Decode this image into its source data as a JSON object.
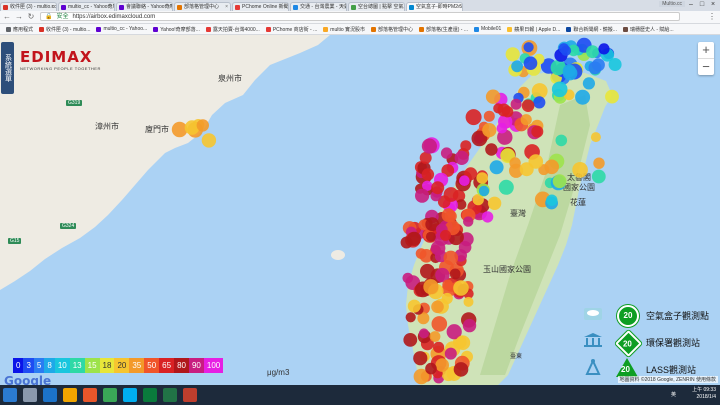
{
  "browser": {
    "tabs": [
      {
        "label": "收件匣 (3) - multio.cc@...",
        "color": "#d93025"
      },
      {
        "label": "multio_cc - Yahoo奇摩...",
        "color": "#5f01d1"
      },
      {
        "label": "會議聯絡 - Yahoo奇摩...",
        "color": "#5f01d1"
      },
      {
        "label": "部落格管理中心",
        "color": "#e37400"
      },
      {
        "label": "PChome Online 新聞台",
        "color": "#e53935"
      },
      {
        "label": "交通 - 台灣農業 - 天氣...",
        "color": "#1e88e5"
      },
      {
        "label": "空台總圖 | 點擊 空氣...",
        "color": "#43a047"
      },
      {
        "label": "空氣盒子-即時PM2.5",
        "color": "#0288d1",
        "active": true
      }
    ],
    "profile": "Multio.cc",
    "url": "https://airbox.edimaxcloud.com",
    "security_label": "安全",
    "bookmarks": [
      {
        "label": "應用程式",
        "color": "#5f6368"
      },
      {
        "label": "收件匣 (3) - multio...",
        "color": "#d93025"
      },
      {
        "label": "multio_cc - Yahoo...",
        "color": "#5f01d1"
      },
      {
        "label": "Yahoo!奇摩部落...",
        "color": "#5f01d1"
      },
      {
        "label": "露天拍賣-台灣4000...",
        "color": "#e53935"
      },
      {
        "label": "PChome 商店街 - ...",
        "color": "#e53935"
      },
      {
        "label": "multio 實況股市",
        "color": "#f9a825"
      },
      {
        "label": "部落格管理中心",
        "color": "#e37400"
      },
      {
        "label": "部落格(生產還) - ...",
        "color": "#e37400"
      },
      {
        "label": "Mobile01",
        "color": "#1e88e5"
      },
      {
        "label": "蘋果日報 | Apple D...",
        "color": "#fbc02d"
      },
      {
        "label": "聯合新聞網 - 鏡搬...",
        "color": "#0d47a1"
      },
      {
        "label": "瑞穗歷史人 - 賦給...",
        "color": "#6d4c41"
      }
    ]
  },
  "map": {
    "logo_main": "EDIMAX",
    "logo_sub": "NETWORKING PEOPLE TOGETHER",
    "side_button": "系統選單",
    "zoom_in": "+",
    "zoom_out": "−",
    "places": {
      "quanzhou": "泉州市",
      "zhangzhou": "漳州市",
      "xiamen": "廈門市",
      "taiwan": "臺灣",
      "taroko": "太魯閣\n國家公園",
      "hualien": "花蓮",
      "yushan": "玉山國家公園",
      "taitung": "臺東"
    },
    "roads": [
      "G319",
      "G324",
      "G15"
    ],
    "copyright": "地圖資料 ©2018 Google, ZENRIN   使用條款",
    "google": "Google"
  },
  "scale": {
    "steps": [
      {
        "label": "0",
        "color": "#0a14e8"
      },
      {
        "label": "3",
        "color": "#1e4cf2"
      },
      {
        "label": "5",
        "color": "#2a7cf2"
      },
      {
        "label": "8",
        "color": "#1ea9e8"
      },
      {
        "label": "10",
        "color": "#19c6de"
      },
      {
        "label": "13",
        "color": "#2ed9a6"
      },
      {
        "label": "15",
        "color": "#9de34b"
      },
      {
        "label": "18",
        "color": "#e8e63a"
      },
      {
        "label": "20",
        "color": "#f6c530"
      },
      {
        "label": "35",
        "color": "#f39a2a"
      },
      {
        "label": "50",
        "color": "#f0552a"
      },
      {
        "label": "65",
        "color": "#d92224"
      },
      {
        "label": "80",
        "color": "#b0171b"
      },
      {
        "label": "90",
        "color": "#c81d80"
      },
      {
        "label": "100",
        "color": "#e61fe3"
      }
    ],
    "unit": "μg/m3"
  },
  "station_legend": [
    {
      "label": "空氣盒子觀測點",
      "badge": "20",
      "icon": "cloud-icon"
    },
    {
      "label": "環保署觀測站",
      "badge": "20",
      "icon": "government-building-icon"
    },
    {
      "label": "LASS觀測站",
      "badge": "20",
      "icon": "lass-tower-icon"
    }
  ],
  "taskbar": {
    "time": "上午 09:33",
    "date": "2018/1/4",
    "ime": "英"
  }
}
